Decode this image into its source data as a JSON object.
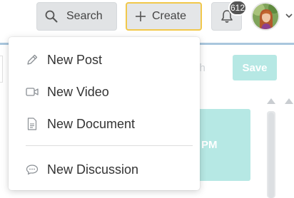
{
  "header": {
    "search_label": "Search",
    "create_label": "Create",
    "notification_count": "612"
  },
  "background": {
    "publish_fragment": "sh",
    "save_label": "Save",
    "card_fragment": "PM"
  },
  "create_menu": {
    "items": [
      {
        "label": "New Post",
        "icon": "pencil-icon"
      },
      {
        "label": "New Video",
        "icon": "video-camera-icon"
      },
      {
        "label": "New Document",
        "icon": "document-icon"
      },
      {
        "label": "New Discussion",
        "icon": "speech-bubble-icon"
      }
    ]
  },
  "colors": {
    "create_focus_border": "#f1c84b",
    "button_bg": "#e4e6e8",
    "accent_teal_light": "#b6e8e4",
    "badge_bg": "#555555"
  }
}
